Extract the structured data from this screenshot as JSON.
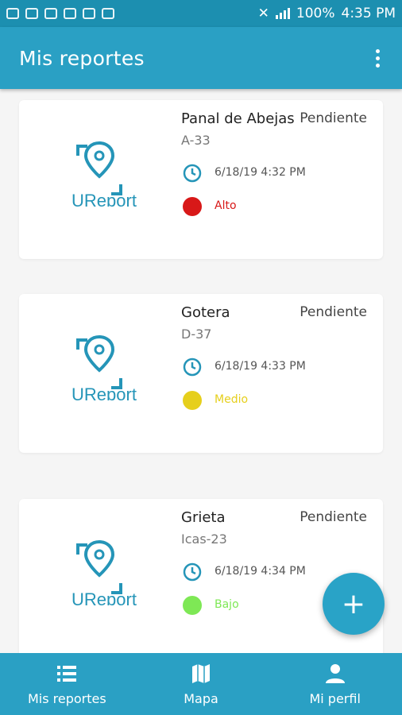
{
  "status_bar": {
    "battery": "100%",
    "time": "4:35 PM"
  },
  "app_bar": {
    "title": "Mis reportes"
  },
  "reports": [
    {
      "logo_text": "UReport",
      "title": "Panal de Abejas",
      "status": "Pendiente",
      "code": "A-33",
      "datetime": "6/18/19 4:32 PM",
      "priority": "Alto",
      "priority_color": "#d81818"
    },
    {
      "logo_text": "UReport",
      "title": "Gotera",
      "status": "Pendiente",
      "code": "D-37",
      "datetime": "6/18/19 4:33 PM",
      "priority": "Medio",
      "priority_color": "#e6cf1c"
    },
    {
      "logo_text": "UReport",
      "title": "Grieta",
      "status": "Pendiente",
      "code": "Icas-23",
      "datetime": "6/18/19 4:34 PM",
      "priority": "Bajo",
      "priority_color": "#7ee855"
    }
  ],
  "fab": {
    "label": "+"
  },
  "bottom_nav": [
    {
      "label": "Mis reportes",
      "icon": "list-icon"
    },
    {
      "label": "Mapa",
      "icon": "map-icon"
    },
    {
      "label": "Mi perfil",
      "icon": "person-icon"
    }
  ],
  "colors": {
    "primary": "#2aa0c4",
    "primary_dark": "#1c8fb0",
    "brand": "#2595b8"
  }
}
